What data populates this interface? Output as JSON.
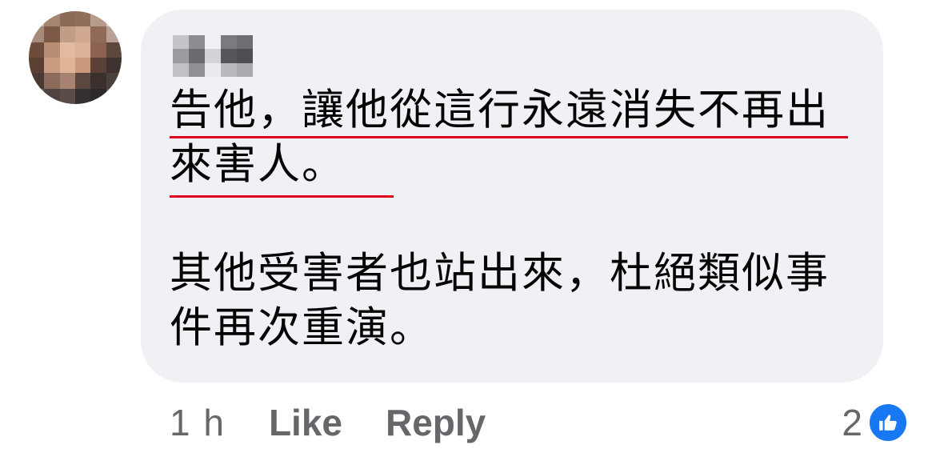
{
  "comment": {
    "paragraphs": [
      "告他，讓他從這行永遠消失不再出來害人。",
      "其他受害者也站出來，杜絕類似事件再次重演。"
    ]
  },
  "actions": {
    "time": "1 h",
    "like_label": "Like",
    "reply_label": "Reply"
  },
  "reactions": {
    "count": "2",
    "icon": "thumbs-up-icon"
  },
  "colors": {
    "bubble": "#eff1f4",
    "underline": "#e0001b",
    "like_blue": "#1877f2",
    "meta_text": "#65676b"
  }
}
